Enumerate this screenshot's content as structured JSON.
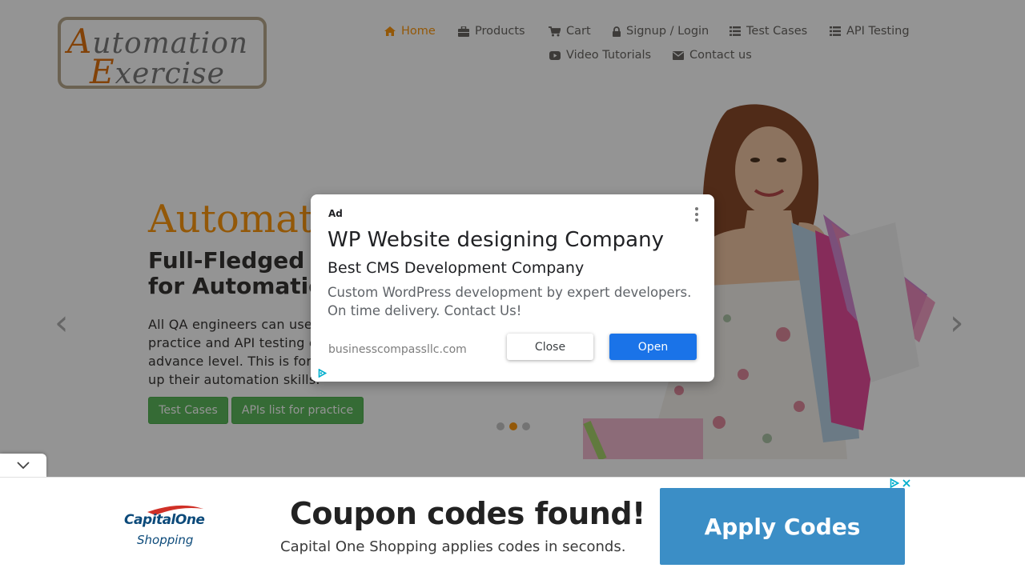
{
  "logo": {
    "line1_cap": "A",
    "line1_rest": "utomation",
    "line2_cap": "E",
    "line2_rest": "xercise"
  },
  "nav": {
    "home": "Home",
    "products": "Products",
    "cart": "Cart",
    "signup": "Signup / Login",
    "test_cases": "Test Cases",
    "api_testing": "API Testing",
    "video": "Video Tutorials",
    "contact": "Contact us"
  },
  "hero": {
    "title": "AutomationExercise",
    "subtitle_line1": "Full-Fledged practice website",
    "subtitle_line2": "for Automation Engineers",
    "description": "All QA engineers can use this website for automation practice and API testing either they are at beginner or advance level. This is for everybody to help them brush up their automation skills.",
    "btn_test_cases": "Test Cases",
    "btn_apis": "APIs list for practice",
    "prev_arrow": "‹",
    "next_arrow": "›",
    "active_slide": 2,
    "slide_count": 3
  },
  "modal_ad": {
    "tag": "Ad",
    "title": "WP Website designing Company",
    "subtitle": "Best CMS Development Company",
    "description": "Custom WordPress development by expert developers. On time delivery. Contact Us!",
    "url": "businesscompassllc.com",
    "close_label": "Close",
    "open_label": "Open"
  },
  "bottom_ad": {
    "brand": "CapitalOne",
    "brand_sub": "Shopping",
    "headline": "Coupon codes found!",
    "subline": "Capital One Shopping applies codes in seconds.",
    "button": "Apply Codes"
  },
  "colors": {
    "accent": "#fe980f",
    "button_green": "#5cb85c",
    "ad_blue": "#1a73e8",
    "banner_blue": "#3b8ec6"
  }
}
